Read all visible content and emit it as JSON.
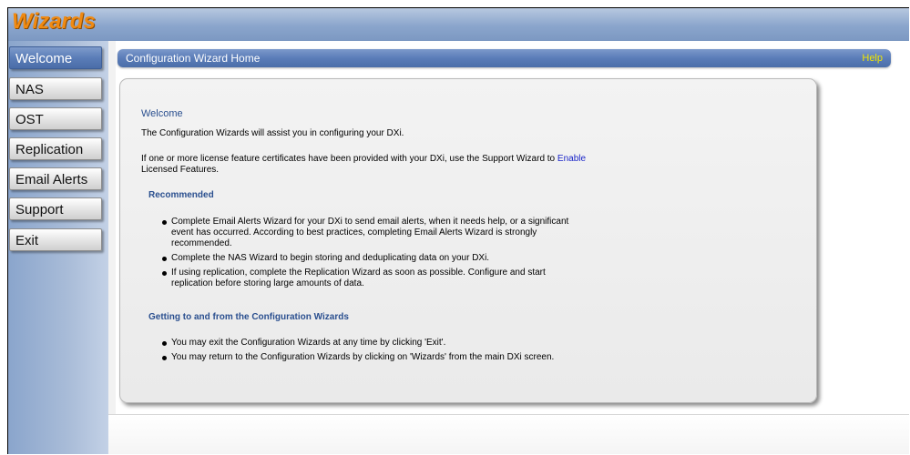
{
  "app": {
    "logo_text": "Wizards"
  },
  "nav": {
    "items": [
      {
        "label": "Welcome",
        "active": true
      },
      {
        "label": "NAS",
        "active": false
      },
      {
        "label": "OST",
        "active": false
      },
      {
        "label": "Replication",
        "active": false
      },
      {
        "label": "Email Alerts",
        "active": false
      },
      {
        "label": "Support",
        "active": false
      },
      {
        "label": "Exit",
        "active": false
      }
    ]
  },
  "panel": {
    "title": "Configuration Wizard Home",
    "help_label": "Help"
  },
  "content": {
    "heading": "Welcome",
    "intro": "The Configuration Wizards will assist you in configuring your DXi.",
    "license_text": "If one or more license feature certificates have been provided with your DXi, use the Support Wizard to",
    "license_link_1": "Enable",
    "license_link_2": "Licensed Features.",
    "recommended": {
      "heading": "Recommended",
      "items": [
        {
          "lines": [
            "Complete Email Alerts Wizard for your DXi to send email alerts, when it needs help, or a significant",
            "event has occurred. According to best practices, completing Email Alerts Wizard is strongly",
            "recommended."
          ]
        },
        {
          "lines": [
            "Complete the NAS Wizard to begin storing and deduplicating data on your DXi."
          ]
        },
        {
          "lines": [
            "If using replication, complete the Replication Wizard as soon as possible. Configure and start",
            "replication before storing large amounts of data."
          ]
        }
      ]
    },
    "navigation": {
      "heading": "Getting to and from the Configuration Wizards",
      "items": [
        {
          "lines": [
            "You may exit the Configuration Wizards at any time by clicking 'Exit'."
          ]
        },
        {
          "lines": [
            "You may return to the Configuration Wizards by clicking on 'Wizards' from the main DXi screen."
          ]
        }
      ]
    }
  },
  "colors": {
    "accent_orange": "#f08a12",
    "header_blue": "#5a7cb8",
    "help_yellow": "#f2e600",
    "link_blue": "#1a25c8",
    "heading_blue": "#2a4f8f"
  }
}
